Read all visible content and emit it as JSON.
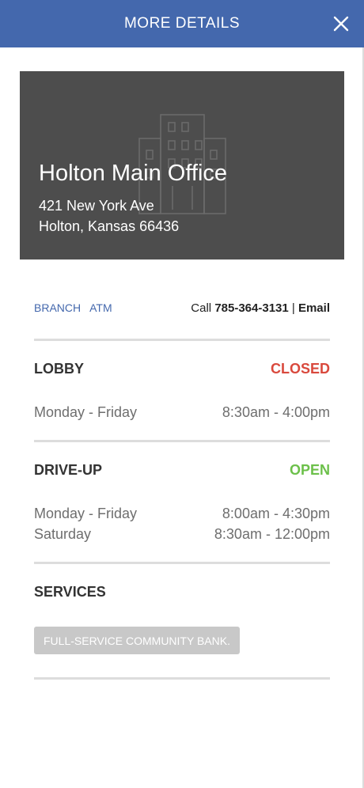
{
  "header": {
    "title": "MORE DETAILS",
    "close_icon": "close-icon"
  },
  "location": {
    "name": "Holton Main Office",
    "address_line1": "421 New York Ave",
    "address_line2": "Holton, Kansas 66436",
    "background_icon": "building-icon"
  },
  "tags": [
    "BRANCH",
    "ATM"
  ],
  "contact": {
    "call_prefix": "Call ",
    "phone": "785-364-3131",
    "separator": " | ",
    "email_label": "Email"
  },
  "lobby": {
    "title": "LOBBY",
    "status": "CLOSED",
    "hours": [
      {
        "days": "Monday - Friday",
        "time": "8:30am - 4:00pm"
      }
    ]
  },
  "drive_up": {
    "title": "DRIVE-UP",
    "status": "OPEN",
    "hours": [
      {
        "days": "Monday - Friday",
        "time": "8:00am - 4:30pm"
      },
      {
        "days": "Saturday",
        "time": "8:30am - 12:00pm"
      }
    ]
  },
  "services": {
    "title": "SERVICES",
    "items": [
      "FULL-SERVICE COMMUNITY BANK."
    ]
  },
  "colors": {
    "header": "#4468ad",
    "closed": "#d9493d",
    "open": "#6cc04a",
    "link": "#4468ad"
  }
}
